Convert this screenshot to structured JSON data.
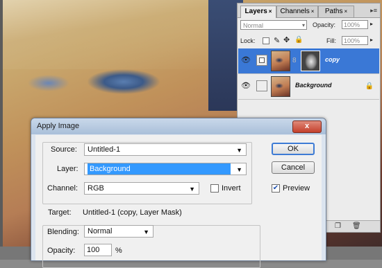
{
  "palette": {
    "tabs": [
      "Layers",
      "Channels",
      "Paths"
    ],
    "blend_mode": "Normal",
    "opacity_label": "Opacity:",
    "opacity_value": "100%",
    "lock_label": "Lock:",
    "fill_label": "Fill:",
    "fill_value": "100%",
    "layers": [
      {
        "name": "copy",
        "selected": true
      },
      {
        "name": "Background",
        "selected": false
      }
    ]
  },
  "dialog": {
    "title": "Apply Image",
    "close_label": "x",
    "source_label": "Source:",
    "source_value": "Untitled-1",
    "layer_label": "Layer:",
    "layer_value": "Background",
    "channel_label": "Channel:",
    "channel_value": "RGB",
    "invert_label": "Invert",
    "target_label": "Target:",
    "target_value": "Untitled-1 (copy, Layer Mask)",
    "blending_label": "Blending:",
    "blending_value": "Normal",
    "opacity_label": "Opacity:",
    "opacity_value": "100",
    "opacity_unit": "%",
    "ok_label": "OK",
    "cancel_label": "Cancel",
    "preview_label": "Preview",
    "preview_checked": true,
    "invert_checked": false
  }
}
